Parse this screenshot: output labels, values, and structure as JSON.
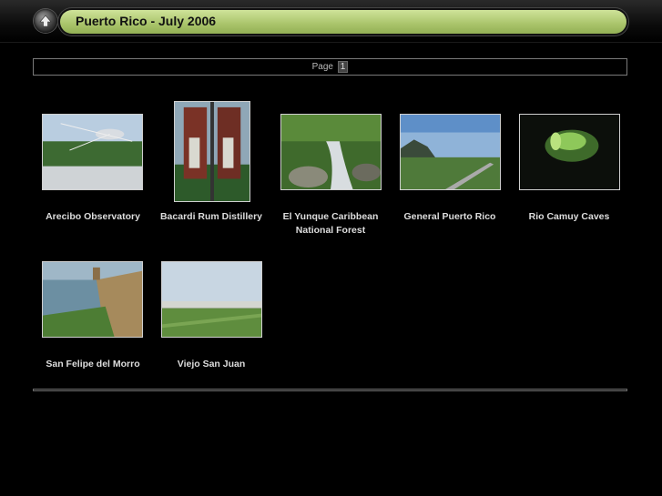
{
  "header": {
    "title": "Puerto Rico - July 2006",
    "up_icon": "up-arrow-icon"
  },
  "pager": {
    "label": "Page",
    "current": "1"
  },
  "albums": [
    {
      "caption": "Arecibo Observatory"
    },
    {
      "caption": "Bacardi Rum Distillery"
    },
    {
      "caption": "El Yunque Caribbean National Forest"
    },
    {
      "caption": "General Puerto Rico"
    },
    {
      "caption": "Rio Camuy Caves"
    },
    {
      "caption": "San Felipe del Morro"
    },
    {
      "caption": "Viejo San Juan"
    }
  ],
  "colors": {
    "title_bar": "#b5cf78",
    "background": "#000000"
  }
}
